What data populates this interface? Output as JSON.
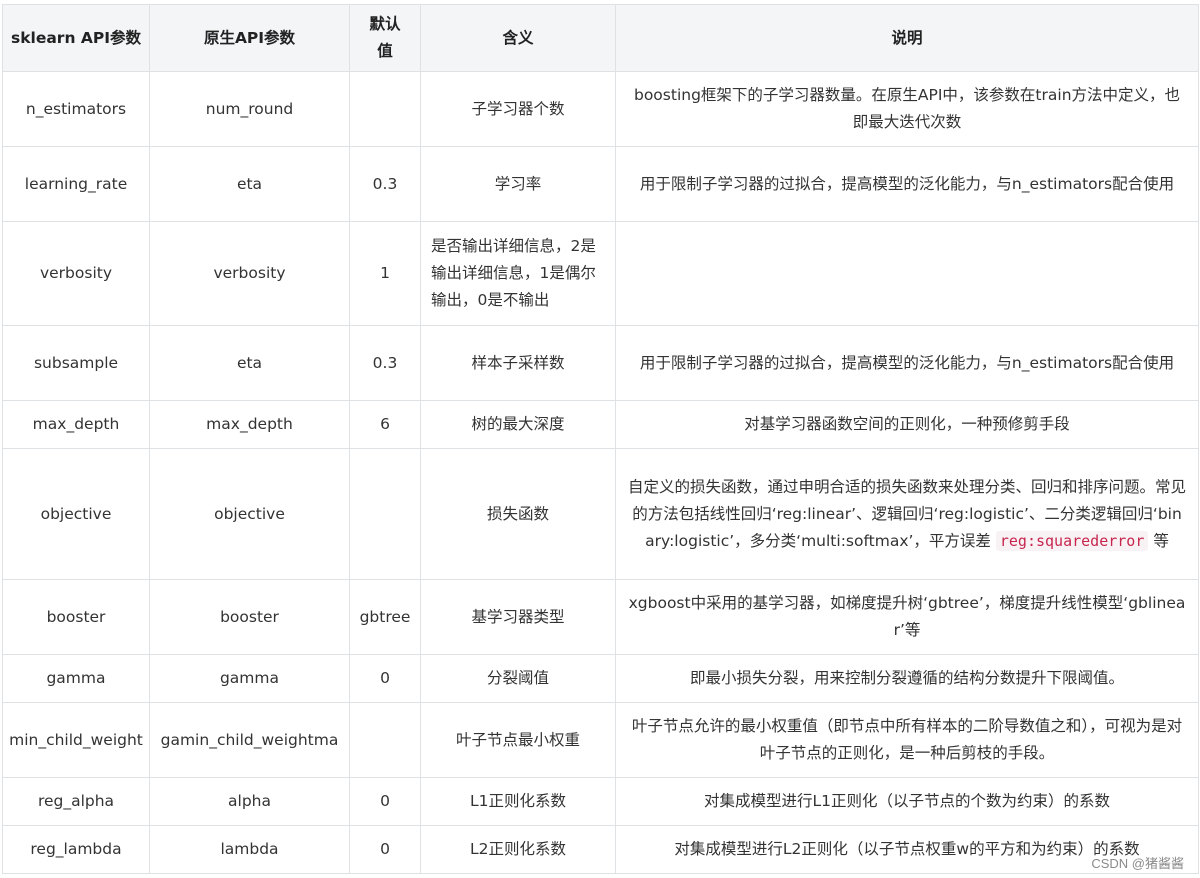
{
  "headers": [
    "sklearn API参数",
    "原生API参数",
    "默认值",
    "含义",
    "说明"
  ],
  "rows": [
    {
      "sklearn": "n_estimators",
      "native": "num_round",
      "default": "",
      "meaning": "子学习器个数",
      "desc": "boosting框架下的子学习器数量。在原生API中，该参数在train方法中定义，也即最大迭代次数"
    },
    {
      "sklearn": "learning_rate",
      "native": "eta",
      "default": "0.3",
      "meaning": "学习率",
      "desc": "用于限制子学习器的过拟合，提高模型的泛化能力，与n_estimators配合使用"
    },
    {
      "sklearn": "verbosity",
      "native": "verbosity",
      "default": "1",
      "meaning": "是否输出详细信息，2是输出详细信息，1是偶尔输出，0是不输出",
      "desc": ""
    },
    {
      "sklearn": "subsample",
      "native": "eta",
      "default": "0.3",
      "meaning": "样本子采样数",
      "desc": "用于限制子学习器的过拟合，提高模型的泛化能力，与n_estimators配合使用"
    },
    {
      "sklearn": "max_depth",
      "native": "max_depth",
      "default": "6",
      "meaning": "树的最大深度",
      "desc": "对基学习器函数空间的正则化，一种预修剪手段"
    },
    {
      "sklearn": "objective",
      "native": "objective",
      "default": "",
      "meaning": "损失函数",
      "desc": "自定义的损失函数，通过申明合适的损失函数来处理分类、回归和排序问题。常见的方法包括线性回归‘reg:linear’、逻辑回归‘reg:logistic’、二分类逻辑回归‘binary:logistic’，多分类‘multi:softmax’，平方误差",
      "desc_code": "reg:squarederror",
      "desc_suffix": "等"
    },
    {
      "sklearn": "booster",
      "native": "booster",
      "default": "gbtree",
      "meaning": "基学习器类型",
      "desc": "xgboost中采用的基学习器，如梯度提升树‘gbtree’，梯度提升线性模型‘gblinear’等"
    },
    {
      "sklearn": "gamma",
      "native": "gamma",
      "default": "0",
      "meaning": "分裂阈值",
      "desc": "即最小损失分裂，用来控制分裂遵循的结构分数提升下限阈值。"
    },
    {
      "sklearn": "min_child_weight",
      "native": "gamin_child_weightma",
      "default": "",
      "meaning": "叶子节点最小权重",
      "desc": "叶子节点允许的最小权重值（即节点中所有样本的二阶导数值之和），可视为是对叶子节点的正则化，是一种后剪枝的手段。"
    },
    {
      "sklearn": "reg_alpha",
      "native": "alpha",
      "default": "0",
      "meaning": "L1正则化系数",
      "desc": "对集成模型进行L1正则化（以子节点的个数为约束）的系数"
    },
    {
      "sklearn": "reg_lambda",
      "native": "lambda",
      "default": "0",
      "meaning": "L2正则化系数",
      "desc": "对集成模型进行L2正则化（以子节点权重w的平方和为约束）的系数"
    }
  ],
  "watermark": "CSDN @猪酱酱"
}
